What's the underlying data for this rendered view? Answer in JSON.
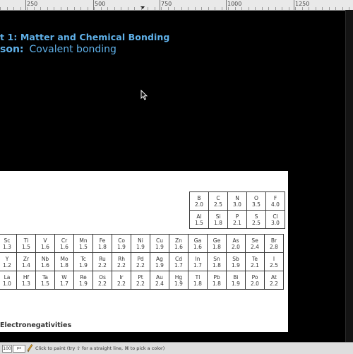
{
  "ruler": {
    "labels": [
      "250",
      "500",
      "750",
      "1000",
      "1250"
    ]
  },
  "slide": {
    "unit_title": "t 1: Matter and Chemical Bonding",
    "lesson_prefix": "son:",
    "lesson_name": "Covalent bonding"
  },
  "periodic_table": {
    "top_block": [
      [
        {
          "sym": "B",
          "en": "2.0"
        },
        {
          "sym": "C",
          "en": "2.5"
        },
        {
          "sym": "N",
          "en": "3.0"
        },
        {
          "sym": "O",
          "en": "3.5"
        },
        {
          "sym": "F",
          "en": "4.0"
        }
      ],
      [
        {
          "sym": "Al",
          "en": "1.5"
        },
        {
          "sym": "Si",
          "en": "1.8"
        },
        {
          "sym": "P",
          "en": "2.1"
        },
        {
          "sym": "S",
          "en": "2.5"
        },
        {
          "sym": "Cl",
          "en": "3.0"
        }
      ]
    ],
    "main_block": [
      [
        {
          "sym": "Sc",
          "en": "1.3"
        },
        {
          "sym": "Ti",
          "en": "1.5"
        },
        {
          "sym": "V",
          "en": "1.6"
        },
        {
          "sym": "Cr",
          "en": "1.6"
        },
        {
          "sym": "Mn",
          "en": "1.5"
        },
        {
          "sym": "Fe",
          "en": "1.8"
        },
        {
          "sym": "Co",
          "en": "1.9"
        },
        {
          "sym": "Ni",
          "en": "1.9"
        },
        {
          "sym": "Cu",
          "en": "1.9"
        },
        {
          "sym": "Zn",
          "en": "1.6"
        },
        {
          "sym": "Ga",
          "en": "1.6"
        },
        {
          "sym": "Ge",
          "en": "1.8"
        },
        {
          "sym": "As",
          "en": "2.0"
        },
        {
          "sym": "Se",
          "en": "2.4"
        },
        {
          "sym": "Br",
          "en": "2.8"
        }
      ],
      [
        {
          "sym": "Y",
          "en": "1.2"
        },
        {
          "sym": "Zr",
          "en": "1.4"
        },
        {
          "sym": "Nb",
          "en": "1.6"
        },
        {
          "sym": "Mo",
          "en": "1.8"
        },
        {
          "sym": "Tc",
          "en": "1.9"
        },
        {
          "sym": "Ru",
          "en": "2.2"
        },
        {
          "sym": "Rh",
          "en": "2.2"
        },
        {
          "sym": "Pd",
          "en": "2.2"
        },
        {
          "sym": "Ag",
          "en": "1.9"
        },
        {
          "sym": "Cd",
          "en": "1.7"
        },
        {
          "sym": "In",
          "en": "1.7"
        },
        {
          "sym": "Sn",
          "en": "1.8"
        },
        {
          "sym": "Sb",
          "en": "1.9"
        },
        {
          "sym": "Te",
          "en": "2.1"
        },
        {
          "sym": "I",
          "en": "2.5"
        }
      ],
      [
        {
          "sym": "La",
          "en": "1.0"
        },
        {
          "sym": "Hf",
          "en": "1.3"
        },
        {
          "sym": "Ta",
          "en": "1.5"
        },
        {
          "sym": "W",
          "en": "1.7"
        },
        {
          "sym": "Re",
          "en": "1.9"
        },
        {
          "sym": "Os",
          "en": "2.2"
        },
        {
          "sym": "Ir",
          "en": "2.2"
        },
        {
          "sym": "Pt",
          "en": "2.2"
        },
        {
          "sym": "Au",
          "en": "2.4"
        },
        {
          "sym": "Hg",
          "en": "1.9"
        },
        {
          "sym": "Tl",
          "en": "1.8"
        },
        {
          "sym": "Pb",
          "en": "1.8"
        },
        {
          "sym": "Bi",
          "en": "1.9"
        },
        {
          "sym": "Po",
          "en": "2.0"
        },
        {
          "sym": "At",
          "en": "2.2"
        }
      ]
    ],
    "caption": "Electronegativities"
  },
  "statusbar": {
    "zoom": "100",
    "unit": "px",
    "message": "Click to paint (try ⇧ for a straight line, ⌘ to pick a color)"
  },
  "icons": {
    "cursor": "arrow-cursor-icon",
    "tool": "pencil-icon"
  },
  "colors": {
    "canvas_bg": "#000000",
    "title_blue": "#5fb0e8"
  }
}
